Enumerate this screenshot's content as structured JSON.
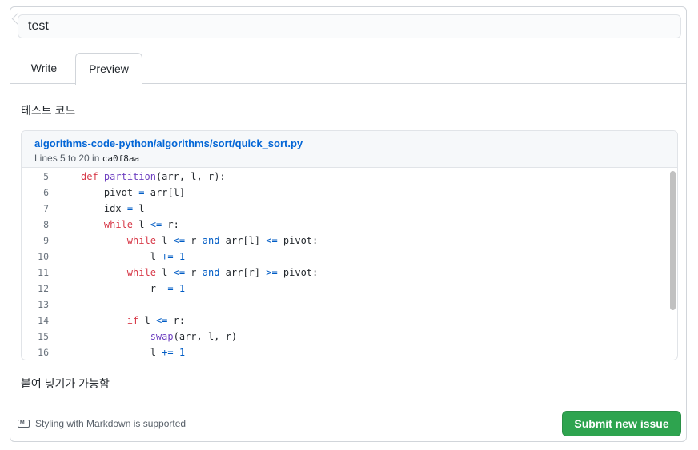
{
  "issue": {
    "title_value": "test"
  },
  "tabs": [
    {
      "label": "Write",
      "active": false
    },
    {
      "label": "Preview",
      "active": true
    }
  ],
  "preview": {
    "intro_text": "테스트 코드",
    "after_text": "붙여 넣기가 가능함",
    "embed": {
      "path": "algorithms-code-python/algorithms/sort/quick_sort.py",
      "lines_label": "Lines 5 to 20 in",
      "commit": "ca0f8aa",
      "code": [
        {
          "n": "5",
          "tokens": [
            [
              "",
              ""
            ],
            [
              "kw",
              "def"
            ],
            [
              "",
              " "
            ],
            [
              "fn",
              "partition"
            ],
            [
              "",
              "(arr, l, r):"
            ]
          ],
          "indent": 0
        },
        {
          "n": "6",
          "tokens": [
            [
              "",
              "pivot "
            ],
            [
              "op",
              "="
            ],
            [
              "",
              " arr[l]"
            ]
          ],
          "indent": 1
        },
        {
          "n": "7",
          "tokens": [
            [
              "",
              "idx "
            ],
            [
              "op",
              "="
            ],
            [
              "",
              " l"
            ]
          ],
          "indent": 1
        },
        {
          "n": "8",
          "tokens": [
            [
              "kw",
              "while"
            ],
            [
              "",
              " l "
            ],
            [
              "op",
              "<="
            ],
            [
              "",
              " r:"
            ]
          ],
          "indent": 1
        },
        {
          "n": "9",
          "tokens": [
            [
              "kw",
              "while"
            ],
            [
              "",
              " l "
            ],
            [
              "op",
              "<="
            ],
            [
              "",
              " r "
            ],
            [
              "op",
              "and"
            ],
            [
              "",
              " arr[l] "
            ],
            [
              "op",
              "<="
            ],
            [
              "",
              " pivot:"
            ]
          ],
          "indent": 2
        },
        {
          "n": "10",
          "tokens": [
            [
              "",
              "l "
            ],
            [
              "op",
              "+="
            ],
            [
              "",
              " "
            ],
            [
              "op",
              "1"
            ]
          ],
          "indent": 3
        },
        {
          "n": "11",
          "tokens": [
            [
              "kw",
              "while"
            ],
            [
              "",
              " l "
            ],
            [
              "op",
              "<="
            ],
            [
              "",
              " r "
            ],
            [
              "op",
              "and"
            ],
            [
              "",
              " arr[r] "
            ],
            [
              "op",
              ">="
            ],
            [
              "",
              " pivot:"
            ]
          ],
          "indent": 2
        },
        {
          "n": "12",
          "tokens": [
            [
              "",
              "r "
            ],
            [
              "op",
              "-="
            ],
            [
              "",
              " "
            ],
            [
              "op",
              "1"
            ]
          ],
          "indent": 3
        },
        {
          "n": "13",
          "tokens": [],
          "indent": 0
        },
        {
          "n": "14",
          "tokens": [
            [
              "kw",
              "if"
            ],
            [
              "",
              " l "
            ],
            [
              "op",
              "<="
            ],
            [
              "",
              " r:"
            ]
          ],
          "indent": 2
        },
        {
          "n": "15",
          "tokens": [
            [
              "fn",
              "swap"
            ],
            [
              "",
              "(arr, l, r)"
            ]
          ],
          "indent": 3
        },
        {
          "n": "16",
          "tokens": [
            [
              "",
              "l "
            ],
            [
              "op",
              "+="
            ],
            [
              "",
              " "
            ],
            [
              "op",
              "1"
            ]
          ],
          "indent": 3
        }
      ]
    }
  },
  "footer": {
    "markdown_icon": "markdown-icon",
    "markdown_icon_text": "M↓",
    "markdown_note": "Styling with Markdown is supported",
    "submit_label": "Submit new issue"
  },
  "colors": {
    "accent_link": "#0366d6",
    "submit_green": "#2ea44f",
    "keyword": "#d73a49",
    "function": "#6f42c1",
    "operator": "#005cc5"
  }
}
